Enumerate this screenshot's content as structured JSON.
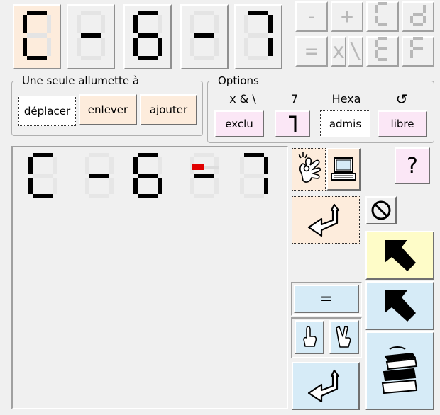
{
  "top_display": {
    "tiles": [
      {
        "glyph": "C",
        "active": true
      },
      {
        "glyph": "-",
        "active": false
      },
      {
        "glyph": "6",
        "active": false
      },
      {
        "glyph": "-",
        "active": false
      },
      {
        "glyph": "7",
        "active": false
      }
    ]
  },
  "keypad": [
    "-",
    "+",
    "C",
    "d",
    "=",
    "x",
    "\\",
    "E",
    "F"
  ],
  "move_group": {
    "legend": "Une seule allumette à",
    "buttons": [
      "déplacer",
      "enlever",
      "ajouter"
    ]
  },
  "options_group": {
    "legend": "Options",
    "headers": [
      "x & \\",
      "7",
      "Hexa",
      "↺"
    ],
    "buttons": [
      "exclu",
      "7",
      "admis",
      "libre"
    ]
  },
  "work_display": [
    "C",
    "-",
    "6",
    "-",
    "7"
  ],
  "side_buttons": {
    "help_label": "?",
    "equals_label": "="
  },
  "colors": {
    "peach": "#fdecdc",
    "light_blue": "#d6ebf7",
    "yellow": "#fefcc8",
    "pink": "#fbe7f6"
  },
  "icons": {
    "ok_hand": "ok-hand-icon",
    "computer": "computer-icon",
    "undo": "undo-arrow-icon",
    "forbidden": "forbidden-icon",
    "arrow_up_left": "arrow-up-left-icon",
    "one_finger": "one-finger-icon",
    "two_fingers": "two-fingers-icon",
    "books": "books-icon"
  }
}
